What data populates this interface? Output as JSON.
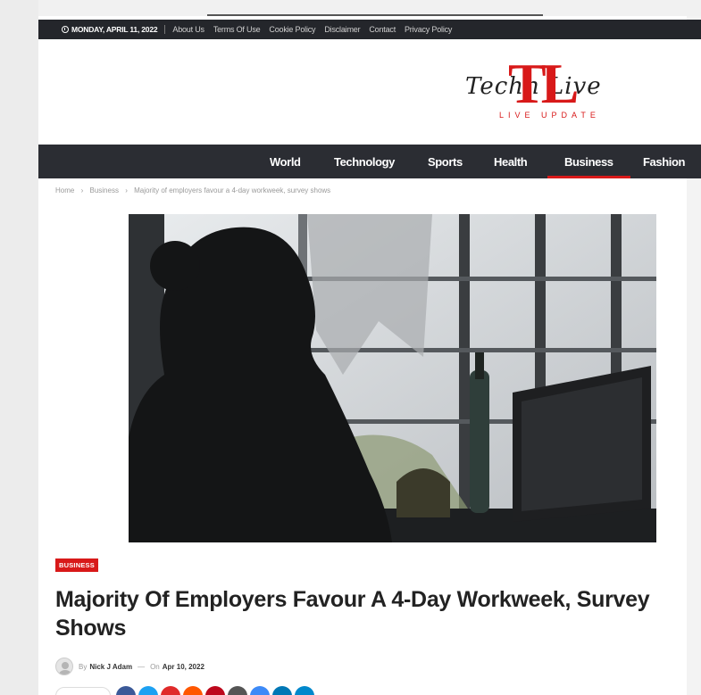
{
  "topbar": {
    "date": "MONDAY, APRIL 11, 2022",
    "links": [
      "About Us",
      "Terms Of Use",
      "Cookie Policy",
      "Disclaimer",
      "Contact",
      "Privacy Policy"
    ]
  },
  "logo": {
    "tag": "LIVE UPDATE"
  },
  "nav": {
    "items": [
      "World",
      "Technology",
      "Sports",
      "Health",
      "Business",
      "Fashion"
    ],
    "active": "Business"
  },
  "breadcrumb": {
    "home": "Home",
    "section": "Business",
    "current": "Majority of employers favour a 4-day workweek, survey shows"
  },
  "article": {
    "category": "BUSINESS",
    "title": "Majority Of Employers Favour A 4-Day Workweek, Survey Shows",
    "by_label": "By",
    "author": "Nick J Adam",
    "on_label": "On",
    "date": "Apr 10, 2022"
  },
  "colors": {
    "accent": "#d81919",
    "topbar": "#24262b",
    "nav": "#2b2d33",
    "share": [
      "#3b5998",
      "#1da1f2",
      "#e02a2a",
      "#ff5700",
      "#bd081c",
      "#555555",
      "#3d8af7",
      "#0077b5",
      "#0088cc"
    ]
  }
}
